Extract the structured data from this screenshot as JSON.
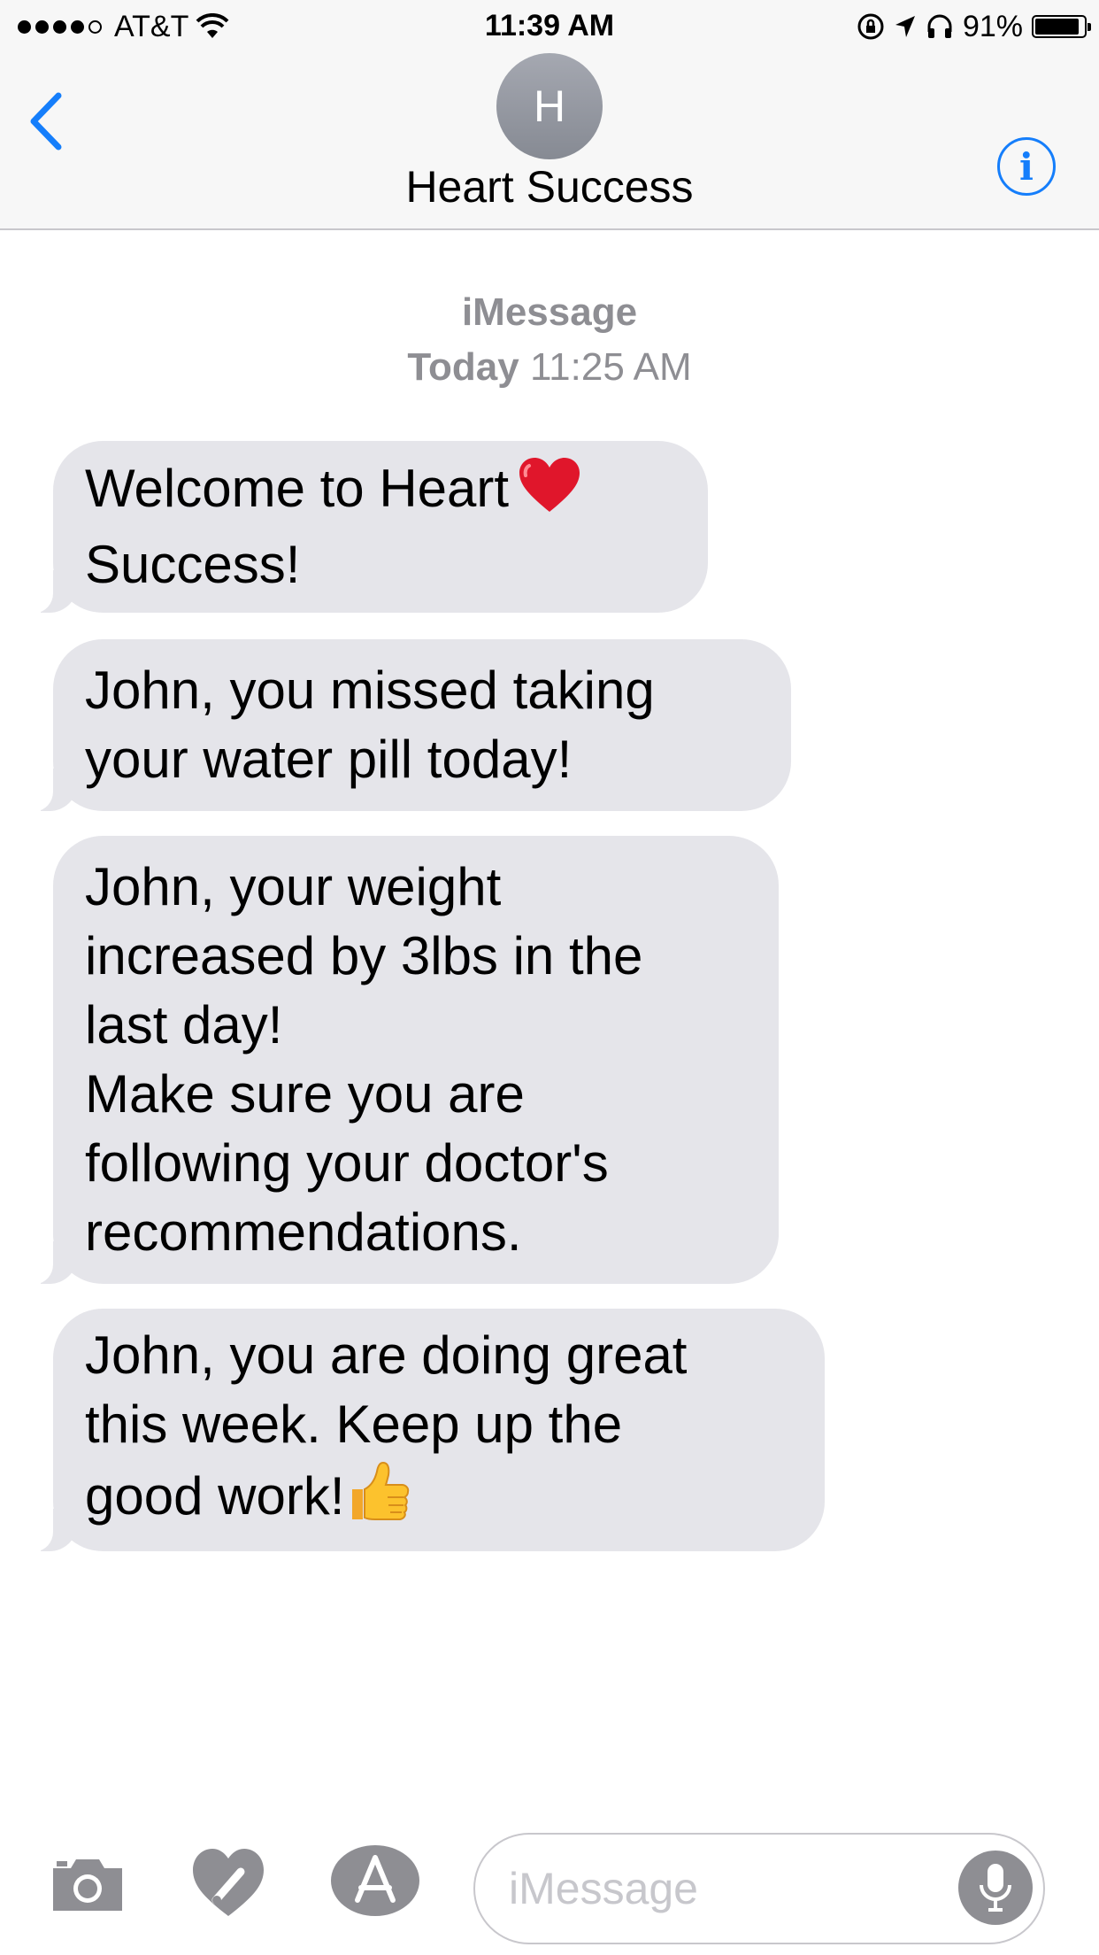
{
  "status_bar": {
    "carrier": "AT&T",
    "time": "11:39 AM",
    "battery": "91%",
    "battery_level": 0.91,
    "signal_bars_filled": 4,
    "signal_bars_total": 5,
    "icons": [
      "wifi-icon",
      "rotation-lock-icon",
      "location-arrow-icon",
      "headphones-icon",
      "battery-icon"
    ]
  },
  "header": {
    "back_icon": "chevron-left-icon",
    "avatar_initial": "H",
    "contact_name": "Heart Success",
    "info_icon": "info-icon",
    "info_glyph": "i"
  },
  "conversation": {
    "service": "iMessage",
    "day": "Today",
    "time": "11:25 AM"
  },
  "messages": [
    {
      "lines": [
        "Welcome to Heart",
        "Success!"
      ],
      "emoji": "red-heart"
    },
    {
      "lines": [
        "John, you missed taking",
        "your water pill today!"
      ]
    },
    {
      "lines": [
        "John, your weight",
        "increased by 3lbs in the",
        "last day!",
        "Make sure you are",
        "following your doctor's",
        "recommendations."
      ]
    },
    {
      "lines": [
        "John, you are doing great",
        "this week. Keep up the",
        "good work!"
      ],
      "emoji": "thumbs-up"
    }
  ],
  "composer": {
    "placeholder": "iMessage",
    "value": "",
    "icons": [
      "camera-icon",
      "digital-touch-icon",
      "app-store-icon",
      "microphone-icon"
    ]
  },
  "colors": {
    "accent": "#157efb",
    "bubble_received": "#e5e5ea",
    "secondary_text": "#8e8e93",
    "bar_background": "#f7f7f7"
  }
}
